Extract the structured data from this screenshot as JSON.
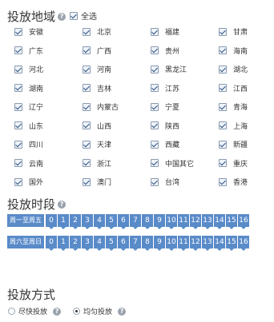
{
  "region": {
    "title": "投放地域",
    "select_all": "全选",
    "provinces": [
      "安徽",
      "北京",
      "福建",
      "甘肃",
      "广东",
      "广西",
      "贵州",
      "海南",
      "河北",
      "河南",
      "黑龙江",
      "湖北",
      "湖南",
      "吉林",
      "江苏",
      "江西",
      "辽宁",
      "内蒙古",
      "宁夏",
      "青海",
      "山东",
      "山西",
      "陕西",
      "上海",
      "四川",
      "天津",
      "西藏",
      "新疆",
      "云南",
      "浙江",
      "中国其它",
      "重庆",
      "国外",
      "澳门",
      "台湾",
      "香港"
    ]
  },
  "schedule": {
    "title": "投放时段",
    "row1_label": "周一至周五",
    "row2_label": "周六至周日",
    "hours": [
      "0",
      "1",
      "2",
      "3",
      "4",
      "5",
      "6",
      "7",
      "8",
      "9",
      "10",
      "11",
      "12",
      "13",
      "14",
      "15",
      "16"
    ]
  },
  "delivery": {
    "title": "投放方式",
    "option_fast": "尽快投放",
    "option_even": "均匀投放"
  }
}
